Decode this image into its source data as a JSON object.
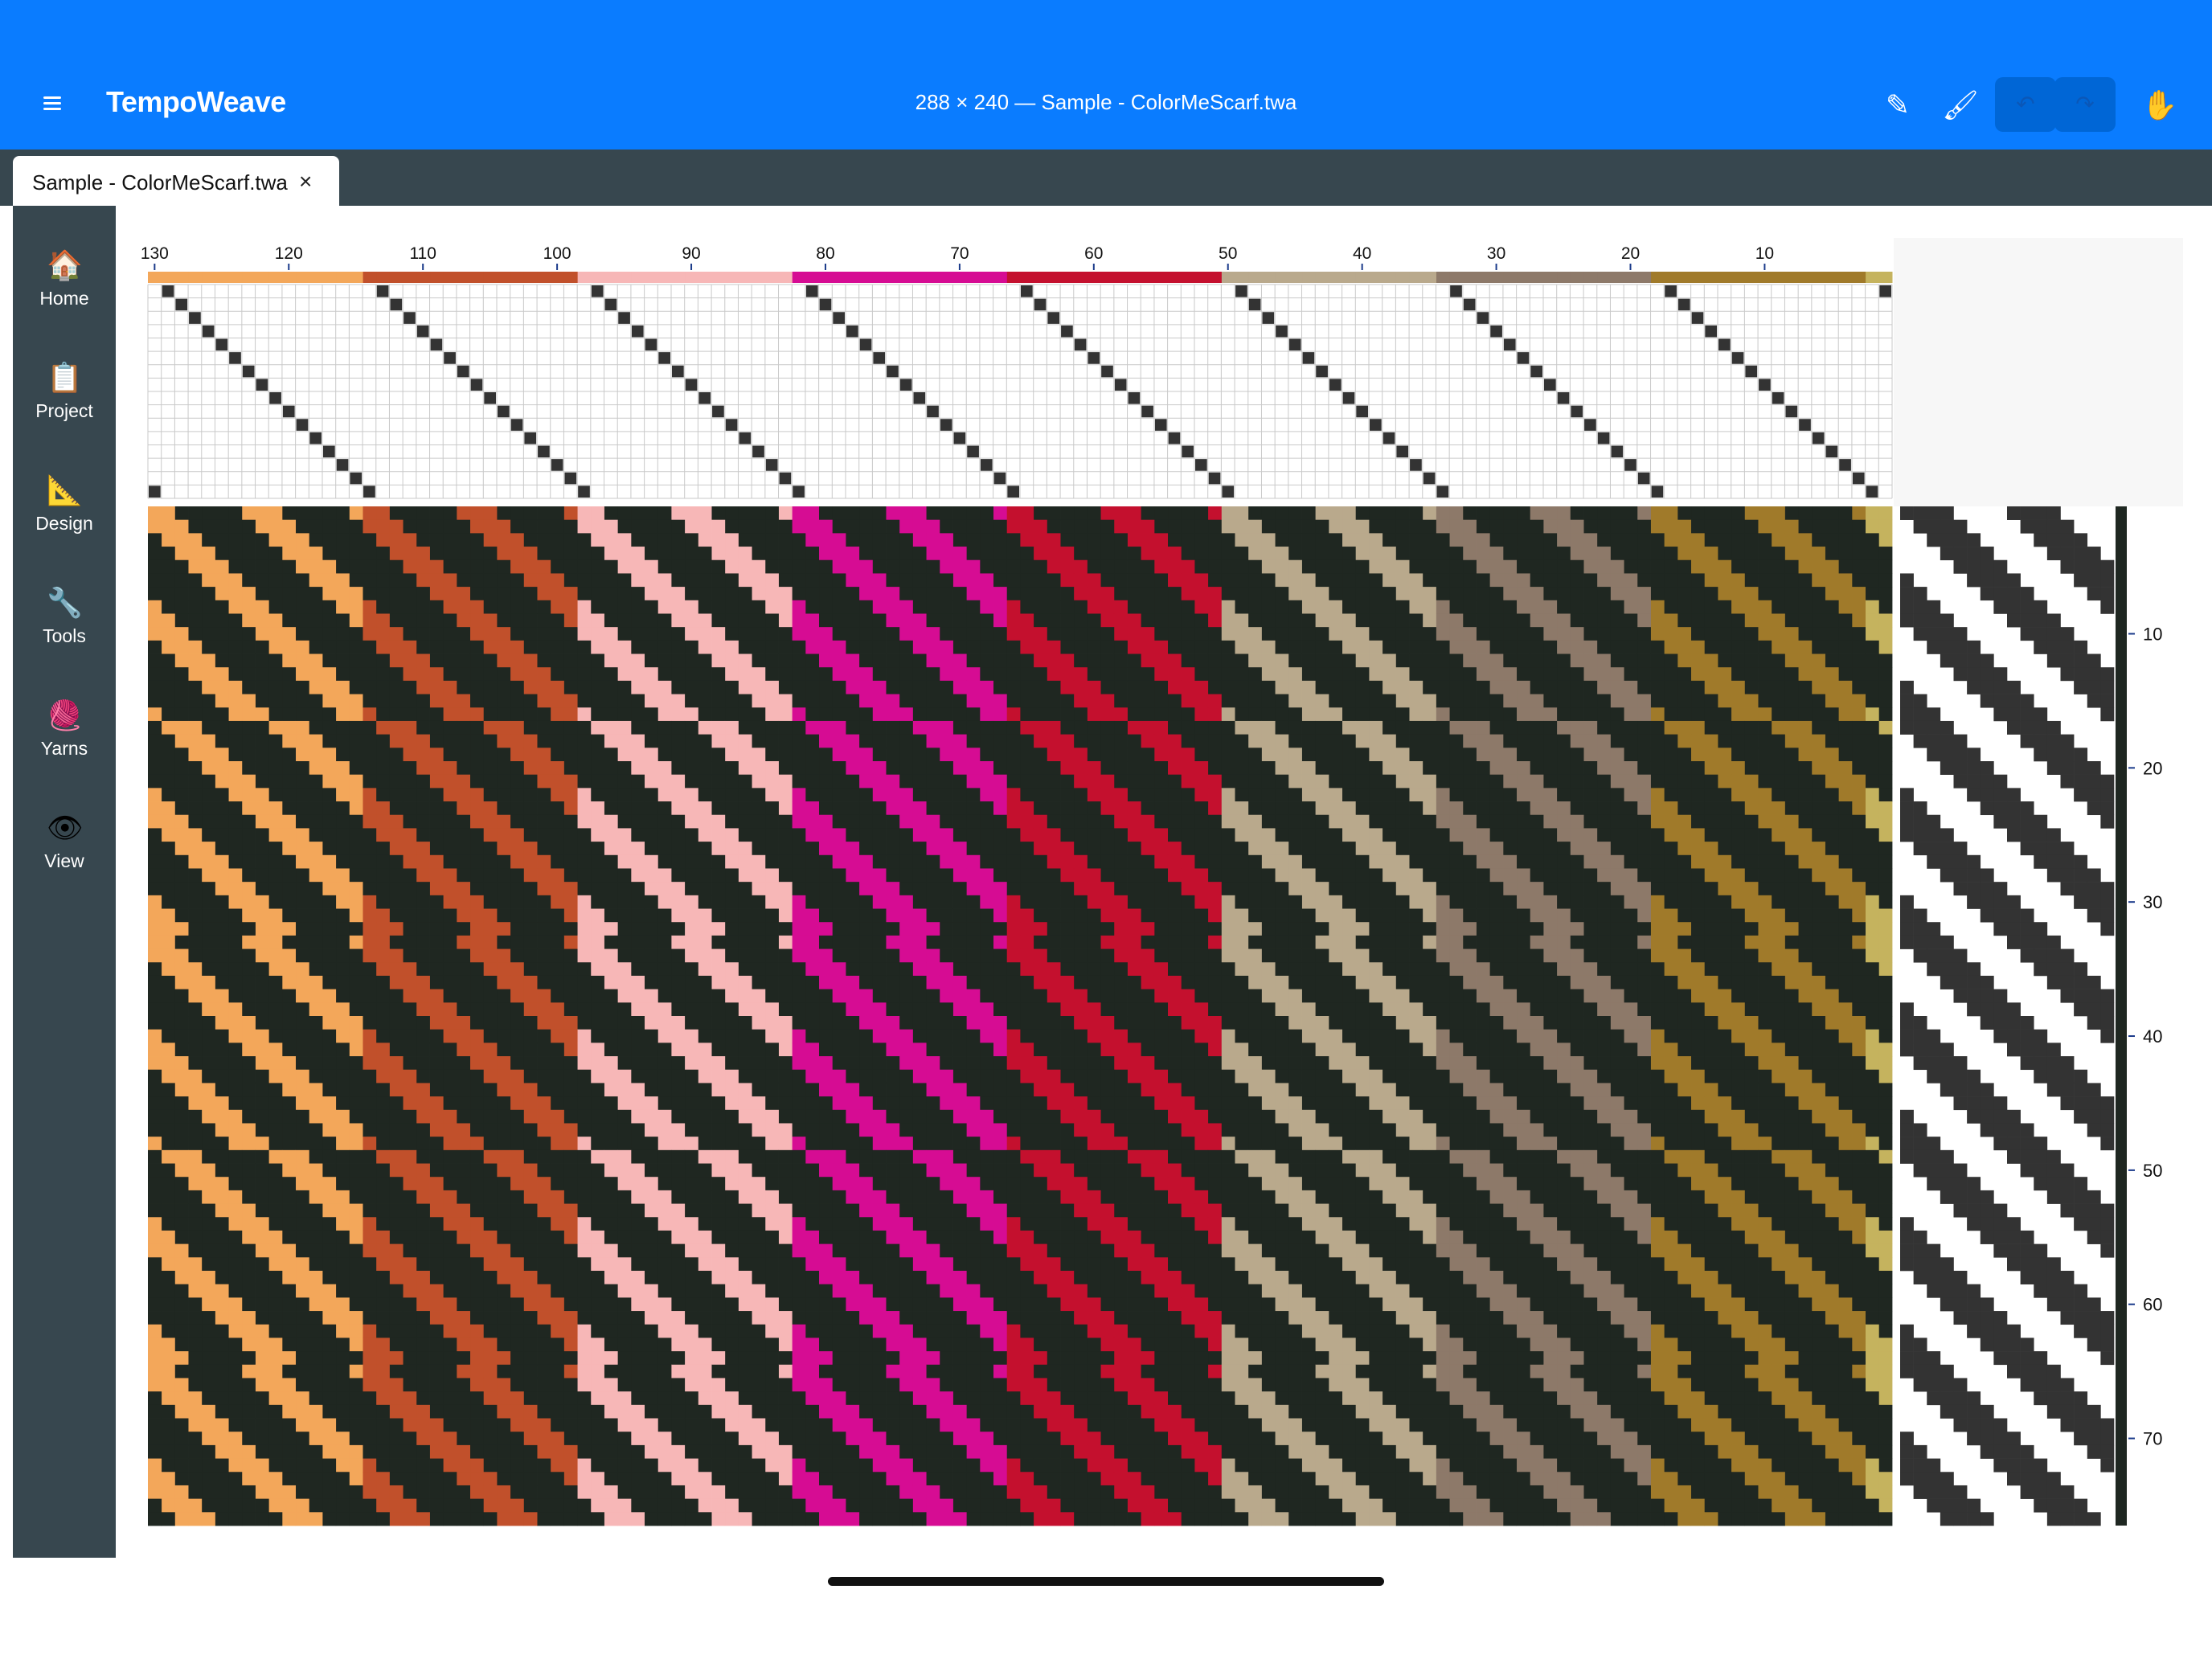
{
  "app": {
    "name": "TempoWeave",
    "document_title": "288 × 240 — Sample - ColorMeScarf.twa"
  },
  "toolbar": {
    "menu_icon": "hamburger-menu-icon",
    "tools": [
      {
        "name": "pencil-tool",
        "glyph": "✎"
      },
      {
        "name": "brush-tool",
        "glyph": "🖌"
      },
      {
        "name": "undo",
        "glyph": "↶"
      },
      {
        "name": "redo",
        "glyph": "↷"
      },
      {
        "name": "hand-tool",
        "glyph": "✋"
      }
    ]
  },
  "tabs": [
    {
      "label": "Sample - ColorMeScarf.twa",
      "close": "×"
    }
  ],
  "sidebar": {
    "items": [
      {
        "label": "Home",
        "icon": "🏠"
      },
      {
        "label": "Project",
        "icon": "📋"
      },
      {
        "label": "Design",
        "icon": "📐"
      },
      {
        "label": "Tools",
        "icon": "🔧"
      },
      {
        "label": "Yarns",
        "icon": "🧶"
      },
      {
        "label": "View",
        "icon": "👁"
      }
    ]
  },
  "draft": {
    "warp_ruler_labels": [
      "130",
      "120",
      "110",
      "100",
      "90",
      "80",
      "70",
      "60",
      "50",
      "40",
      "30",
      "20",
      "10"
    ],
    "weft_ruler_labels": [
      "10",
      "20",
      "30",
      "40",
      "50",
      "60",
      "70"
    ],
    "warp_colors": [
      "#a07a2a",
      "#8d7969",
      "#b9a98c",
      "#c4102e",
      "#d60c93",
      "#f7b7b7",
      "#c1502b",
      "#f3a75a",
      "#c5b35e"
    ],
    "weft_color": "#1f2721",
    "grid_line_color": "#c9c9c9",
    "threading_fill": "#333333"
  }
}
